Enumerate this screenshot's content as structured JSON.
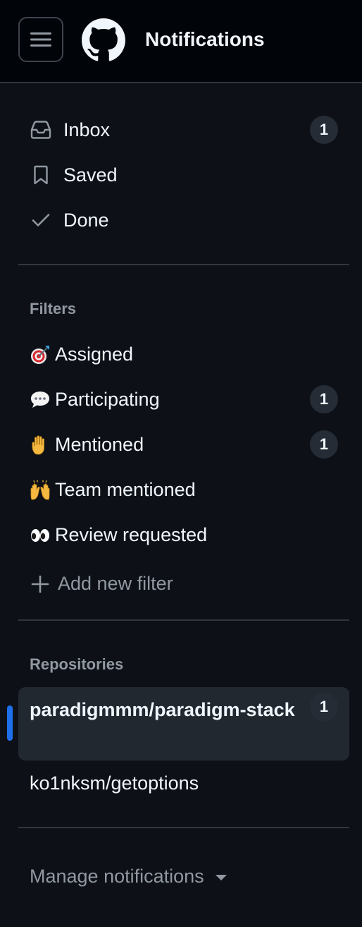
{
  "header": {
    "title": "Notifications",
    "menu_icon": "hamburger-icon",
    "logo_icon": "github-logo"
  },
  "nav": {
    "items": [
      {
        "label": "Inbox",
        "icon": "inbox-icon",
        "count": "1"
      },
      {
        "label": "Saved",
        "icon": "bookmark-icon"
      },
      {
        "label": "Done",
        "icon": "check-icon"
      }
    ]
  },
  "filters": {
    "heading": "Filters",
    "items": [
      {
        "label": "Assigned",
        "icon": "dart-emoji-icon"
      },
      {
        "label": "Participating",
        "icon": "speech-bubble-emoji-icon",
        "count": "1"
      },
      {
        "label": "Mentioned",
        "icon": "raised-hand-emoji-icon",
        "count": "1"
      },
      {
        "label": "Team mentioned",
        "icon": "raising-hands-emoji-icon"
      },
      {
        "label": "Review requested",
        "icon": "eyes-emoji-icon"
      }
    ],
    "add_label": "Add new filter"
  },
  "repositories": {
    "heading": "Repositories",
    "items": [
      {
        "label": "paradigmmm/paradigm-stack",
        "count": "1",
        "active": true
      },
      {
        "label": "ko1nksm/getoptions"
      }
    ]
  },
  "footer": {
    "manage_label": "Manage notifications"
  },
  "colors": {
    "background": "#0d1117",
    "header_background": "#010409",
    "accent": "#1f6feb",
    "muted_text": "#9198a1",
    "counter_bg": "#262c36"
  }
}
